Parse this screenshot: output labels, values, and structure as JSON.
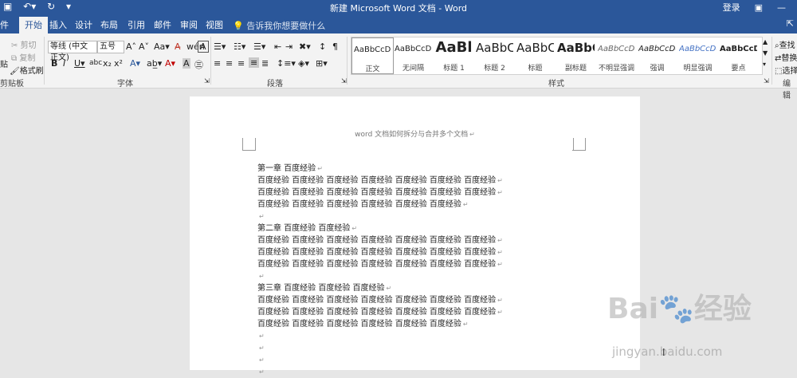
{
  "window": {
    "title": "新建 Microsoft Word 文档 - Word",
    "login": "登录"
  },
  "tabs": [
    "件",
    "开始",
    "插入",
    "设计",
    "布局",
    "引用",
    "邮件",
    "审阅",
    "视图"
  ],
  "tell_me": "告诉我你想要做什么",
  "clipboard": {
    "cut": "剪切",
    "copy": "复制",
    "format_painter": "格式刷",
    "paste_fragment": "贴",
    "label": "剪贴板"
  },
  "font": {
    "family": "等线 (中文正文)",
    "size": "五号",
    "label": "字体"
  },
  "paragraph": {
    "label": "段落"
  },
  "styles": {
    "label": "样式",
    "items": [
      {
        "preview": "AaBbCcDc",
        "name": "正文"
      },
      {
        "preview": "AaBbCcDc",
        "name": "无间隔"
      },
      {
        "preview": "AaBl",
        "name": "标题 1"
      },
      {
        "preview": "AaBbC",
        "name": "标题 2"
      },
      {
        "preview": "AaBbC",
        "name": "标题"
      },
      {
        "preview": "AaBbC",
        "name": "副标题"
      },
      {
        "preview": "AaBbCcDc",
        "name": "不明显强调"
      },
      {
        "preview": "AaBbCcDc",
        "name": "强调"
      },
      {
        "preview": "AaBbCcDc",
        "name": "明显强调"
      },
      {
        "preview": "AaBbCcD",
        "name": "要点"
      }
    ]
  },
  "editing": {
    "find": "查找",
    "replace": "替换",
    "select": "选择",
    "label": "编辑"
  },
  "document": {
    "header": "word 文档如何拆分与合并多个文档",
    "lines": [
      "第一章  百度经验",
      "百度经验  百度经验  百度经验  百度经验  百度经验  百度经验  百度经验",
      "百度经验  百度经验  百度经验  百度经验  百度经验  百度经验  百度经验",
      "百度经验  百度经验  百度经验  百度经验  百度经验  百度经验",
      "",
      "第二章  百度经验  百度经验",
      "百度经验  百度经验  百度经验  百度经验  百度经验  百度经验  百度经验",
      "百度经验  百度经验  百度经验  百度经验  百度经验  百度经验  百度经验",
      "百度经验  百度经验  百度经验  百度经验  百度经验  百度经验  百度经验",
      "",
      "第三章  百度经验  百度经验  百度经验",
      "百度经验  百度经验  百度经验  百度经验  百度经验  百度经验  百度经验",
      "百度经验  百度经验  百度经验  百度经验  百度经验  百度经验  百度经验",
      "百度经验  百度经验  百度经验  百度经验  百度经验  百度经验",
      "",
      "",
      "",
      ""
    ],
    "para_mark": "↵"
  },
  "watermark": {
    "logo": "Bai🐾经验",
    "url": "jingyan.baidu.com"
  },
  "colors": {
    "titlebar": "#2b579a",
    "ribbon": "#f3f3f3",
    "canvas": "#e6e6e6"
  }
}
